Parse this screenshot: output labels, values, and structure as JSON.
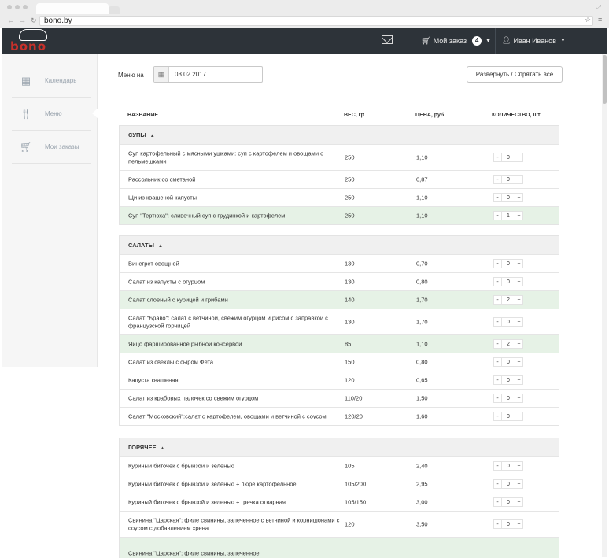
{
  "browser": {
    "url": "bono.by"
  },
  "header": {
    "logo_text": "bono",
    "order_label": "Мой заказ",
    "order_count": "4",
    "user_name": "Иван Иванов"
  },
  "sidebar": {
    "items": [
      {
        "label": "Календарь",
        "icon": "calendar-icon"
      },
      {
        "label": "Меню",
        "icon": "fork-knife-icon"
      },
      {
        "label": "Мои заказы",
        "icon": "cart-icon"
      }
    ]
  },
  "toolbar": {
    "menu_for_label": "Меню на",
    "date_value": "03.02.2017",
    "toggle_all_label": "Развернуть / Спрятать всё"
  },
  "columns": {
    "name": "НАЗВАНИЕ",
    "weight": "ВЕС, гр",
    "price": "ЦЕНА, руб",
    "quantity": "КОЛИЧЕСТВО, шт"
  },
  "sections": [
    {
      "title": "СУПЫ",
      "items": [
        {
          "name": "Суп картофельный с мясными ушками: суп с картофелем и овощами с пельмешками",
          "weight": "250",
          "price": "1,10",
          "qty": "0",
          "selected": false
        },
        {
          "name": "Рассольник со сметаной",
          "weight": "250",
          "price": "0,87",
          "qty": "0",
          "selected": false
        },
        {
          "name": "Щи из квашеной капусты",
          "weight": "250",
          "price": "1,10",
          "qty": "0",
          "selected": false
        },
        {
          "name": "Суп \"Тертюха\": сливочный суп с грудинкой и картофелем",
          "weight": "250",
          "price": "1,10",
          "qty": "1",
          "selected": true
        }
      ]
    },
    {
      "title": "САЛАТЫ",
      "items": [
        {
          "name": "Винегрет овощной",
          "weight": "130",
          "price": "0,70",
          "qty": "0",
          "selected": false
        },
        {
          "name": "Салат из капусты с огурцом",
          "weight": "130",
          "price": "0,80",
          "qty": "0",
          "selected": false
        },
        {
          "name": "Салат слоеный с курицей и грибами",
          "weight": "140",
          "price": "1,70",
          "qty": "2",
          "selected": true
        },
        {
          "name": "Салат \"Браво\": салат с ветчиной, свежим огурцом и рисом с заправкой с французской горчицей",
          "weight": "130",
          "price": "1,70",
          "qty": "0",
          "selected": false
        },
        {
          "name": "Яйцо фаршированное рыбной консервой",
          "weight": "85",
          "price": "1,10",
          "qty": "2",
          "selected": true
        },
        {
          "name": "Салат из свеклы с сыром Фета",
          "weight": "150",
          "price": "0,80",
          "qty": "0",
          "selected": false
        },
        {
          "name": "Капуста квашеная",
          "weight": "120",
          "price": "0,65",
          "qty": "0",
          "selected": false
        },
        {
          "name": "Салат из крабовых палочек со свежим огурцом",
          "weight": "110/20",
          "price": "1,50",
          "qty": "0",
          "selected": false
        },
        {
          "name": "Салат \"Московский\":салат с картофелем, овощами и ветчиной с соусом",
          "weight": "120/20",
          "price": "1,60",
          "qty": "0",
          "selected": false
        }
      ]
    },
    {
      "title": "ГОРЯЧЕЕ",
      "items": [
        {
          "name": "Куриный биточек с брынзой и зеленью",
          "weight": "105",
          "price": "2,40",
          "qty": "0",
          "selected": false
        },
        {
          "name": "Куриный биточек с брынзой и зеленью + пюре картофельное",
          "weight": "105/200",
          "price": "2,95",
          "qty": "0",
          "selected": false
        },
        {
          "name": "Куриный биточек с брынзой и зеленью + гречка отварная",
          "weight": "105/150",
          "price": "3,00",
          "qty": "0",
          "selected": false
        },
        {
          "name": "Свинина \"Царская\": филе свинины, запеченное с ветчиной и корнишонами с соусом с добавлением хрена",
          "weight": "120",
          "price": "3,50",
          "qty": "0",
          "selected": false
        },
        {
          "name": "Свинина \"Царская\": филе свинины, запеченное",
          "weight": "",
          "price": "",
          "qty": "",
          "selected": true
        }
      ]
    }
  ]
}
